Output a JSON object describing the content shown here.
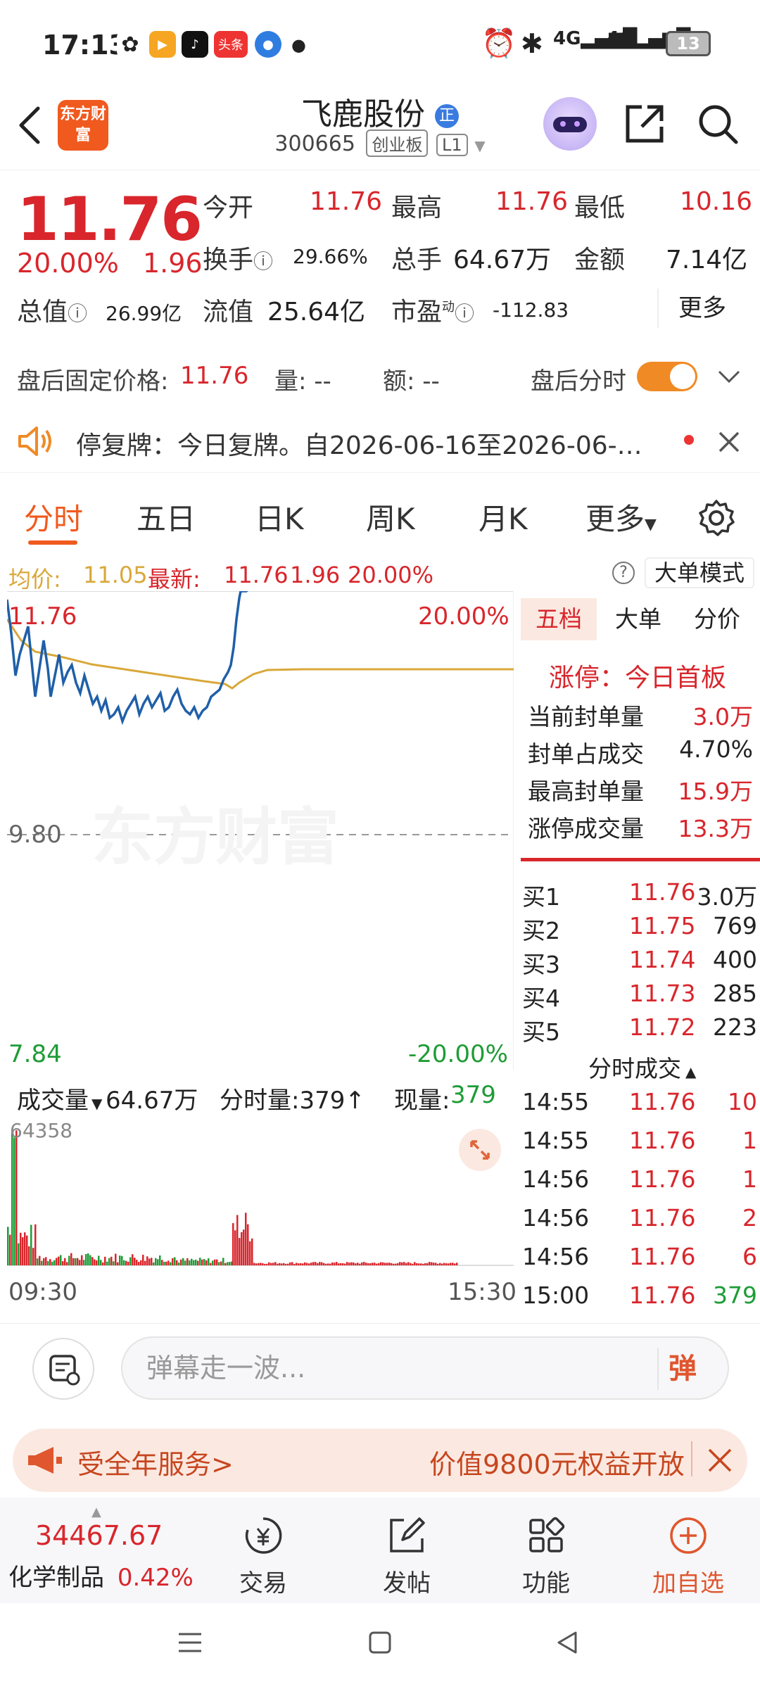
{
  "status_bar": {
    "time": "17:13",
    "battery": "13",
    "app_badge": "头条"
  },
  "header": {
    "logo_text": "东方财富",
    "stock_name": "飞鹿股份",
    "name_badge": "正",
    "stock_code": "300665",
    "board_tag": "创业板",
    "level_tag": "L1"
  },
  "quote": {
    "price": "11.76",
    "change_pct": "20.00%",
    "change": "1.96",
    "open_label": "今开",
    "open": "11.76",
    "high_label": "最高",
    "high": "11.76",
    "low_label": "最低",
    "low": "10.16",
    "turnover_label": "换手",
    "turnover": "29.66%",
    "volume_label": "总手",
    "volume": "64.67万",
    "amount_label": "金额",
    "amount": "7.14亿",
    "mktcap_label": "总值",
    "mktcap": "26.99亿",
    "float_label": "流值",
    "float": "25.64亿",
    "pe_label": "市盈",
    "pe_sup": "动",
    "pe": "-112.83",
    "more_label": "更多"
  },
  "after_hours": {
    "fixed_price_label": "盘后固定价格:",
    "fixed_price": "11.76",
    "qty_label": "量: --",
    "amt_label": "额: --",
    "intraday_label": "盘后分时"
  },
  "notice": {
    "text": "停复牌：今日复牌。自2026-06-16至2026-06-…"
  },
  "tabs": [
    {
      "label": "分时"
    },
    {
      "label": "五日"
    },
    {
      "label": "日K"
    },
    {
      "label": "周K"
    },
    {
      "label": "月K"
    },
    {
      "label": "更多"
    }
  ],
  "avg_row": {
    "avg_label": "均价:",
    "avg": "11.05",
    "latest_label": "最新:",
    "latest": "11.76",
    "latest_change": "1.96",
    "latest_pct": "20.00%",
    "big_order_mode": "大单模式"
  },
  "chart_labels": {
    "top_price": "11.76",
    "top_pct": "20.00%",
    "mid_price": "9.80",
    "bottom_price": "7.84",
    "bottom_pct": "-20.00%"
  },
  "panel": {
    "tabs": [
      "五档",
      "大单",
      "分价"
    ],
    "limit_up_label": "涨停：今日首板",
    "stats": [
      {
        "label": "当前封单量",
        "value": "3.0万"
      },
      {
        "label": "封单占成交",
        "value": "4.70%"
      },
      {
        "label": "最高封单量",
        "value": "15.9万"
      },
      {
        "label": "涨停成交量",
        "value": "13.3万"
      }
    ],
    "bids": [
      {
        "label": "买1",
        "price": "11.76",
        "qty": "3.0万"
      },
      {
        "label": "买2",
        "price": "11.75",
        "qty": "769"
      },
      {
        "label": "买3",
        "price": "11.74",
        "qty": "400"
      },
      {
        "label": "买4",
        "price": "11.73",
        "qty": "285"
      },
      {
        "label": "买5",
        "price": "11.72",
        "qty": "223"
      }
    ],
    "trades_title": "分时成交",
    "trades": [
      {
        "time": "14:55",
        "price": "11.76",
        "qty": "10"
      },
      {
        "time": "14:55",
        "price": "11.76",
        "qty": "1"
      },
      {
        "time": "14:56",
        "price": "11.76",
        "qty": "1"
      },
      {
        "time": "14:56",
        "price": "11.76",
        "qty": "2"
      },
      {
        "time": "14:56",
        "price": "11.76",
        "qty": "6"
      },
      {
        "time": "15:00",
        "price": "11.76",
        "qty": "379"
      }
    ]
  },
  "volume": {
    "label": "成交量",
    "total": "64.67万",
    "tick_label": "分时量:379↑",
    "now_label": "现量:",
    "now": "379",
    "max": "64358",
    "start_time": "09:30",
    "end_time": "15:30"
  },
  "comment": {
    "placeholder": "弹幕走一波...",
    "danmu_btn": "弹"
  },
  "promo": {
    "left": "受全年服务>",
    "right": "价值9800元权益开放"
  },
  "bottom_bar": {
    "index_value": "34467.67",
    "index_name": "化学制品",
    "index_pct": "0.42%",
    "items": [
      "交易",
      "发帖",
      "功能",
      "加自选"
    ]
  },
  "colors": {
    "up": "#d8262c",
    "down": "#1e9c36",
    "accent": "#f05a1e",
    "price_line": "#1f5fa8",
    "avg_line": "#d9a83a"
  }
}
